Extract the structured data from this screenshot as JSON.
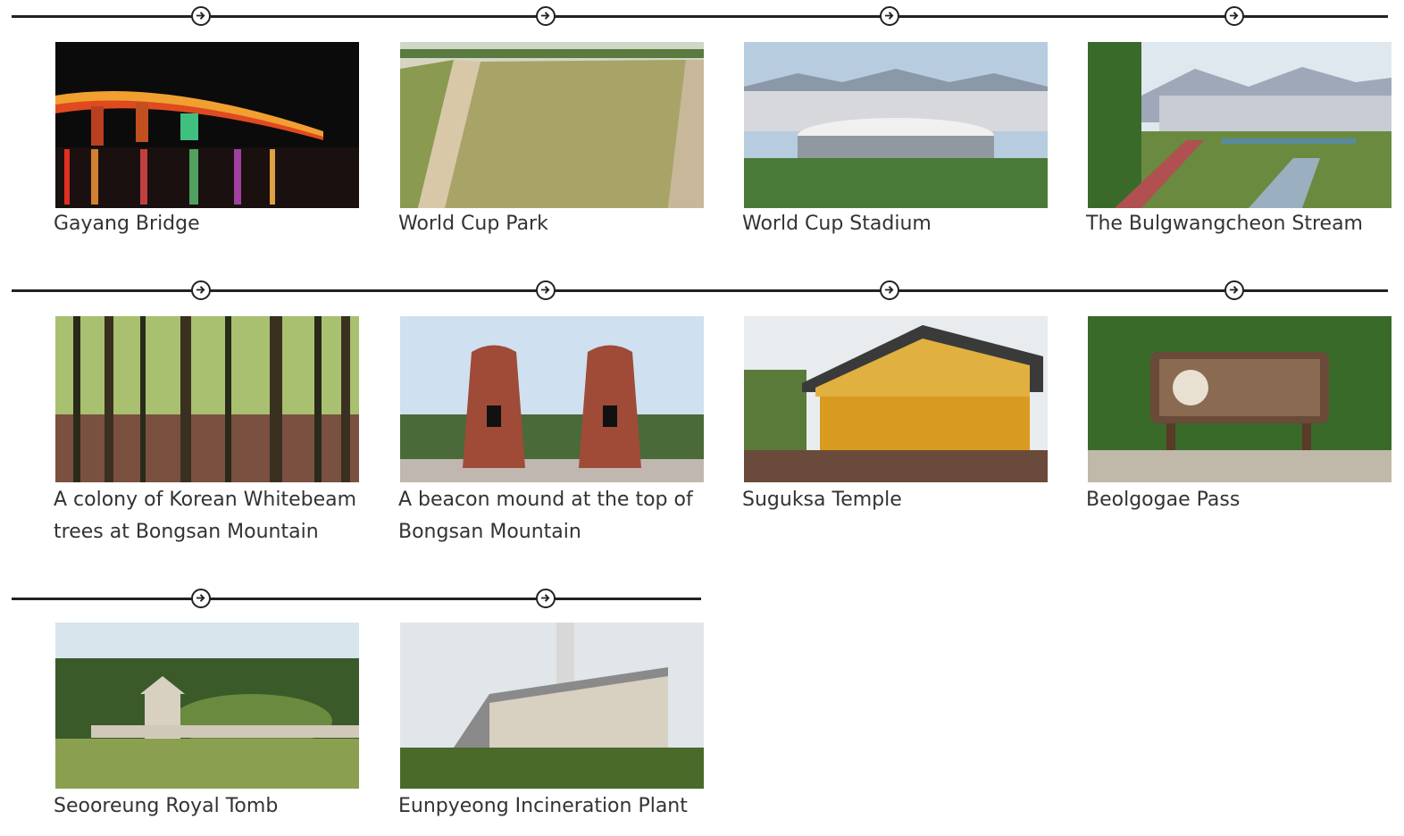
{
  "items": [
    {
      "caption": "Gayang Bridge",
      "photo": "night bridge photo"
    },
    {
      "caption": "World Cup Park",
      "photo": "grass field photo"
    },
    {
      "caption": "World Cup Stadium",
      "photo": "stadium photo"
    },
    {
      "caption": "The Bulgwangcheon Stream",
      "photo": "stream photo"
    },
    {
      "caption": "A colony of Korean Whitebeam trees at Bongsan Mountain",
      "photo": "forest photo"
    },
    {
      "caption": "A beacon mound at the top of Bongsan Mountain",
      "photo": "beacon towers photo"
    },
    {
      "caption": "Suguksa Temple",
      "photo": "golden temple photo"
    },
    {
      "caption": "Beolgogae Pass",
      "photo": "sign board photo"
    },
    {
      "caption": "Seooreung Royal Tomb",
      "photo": "royal tomb photo"
    },
    {
      "caption": "Eunpyeong Incineration Plant",
      "photo": "plant building photo"
    }
  ],
  "icons": {
    "arrow": "arrow-right-circle-icon"
  }
}
